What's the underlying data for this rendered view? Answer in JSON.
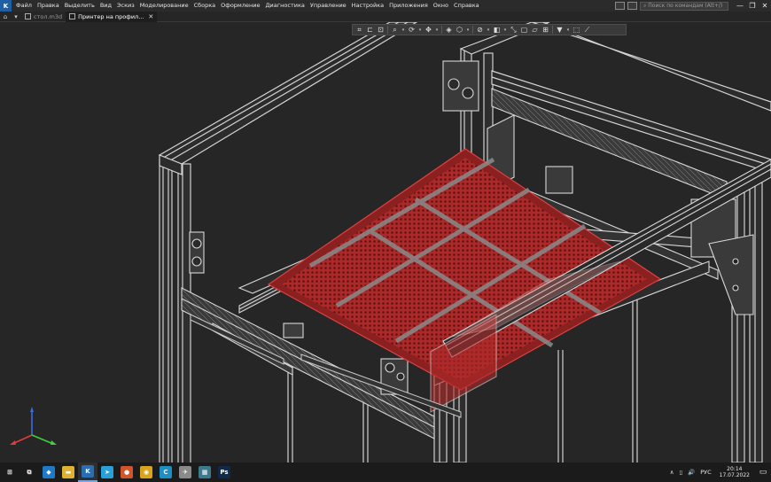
{
  "menubar": {
    "app_icon": "kompas-icon",
    "items": [
      "Файл",
      "Правка",
      "Выделить",
      "Вид",
      "Эскиз",
      "Моделирование",
      "Сборка",
      "Оформление",
      "Диагностика",
      "Управление",
      "Настройка",
      "Приложения",
      "Окно",
      "Справка"
    ],
    "search_placeholder": "Поиск по командам (Alt+/)",
    "window_controls": [
      "—",
      "❐",
      "✕"
    ]
  },
  "tabs": {
    "home_icon": "home-icon",
    "items": [
      {
        "label": "стол.m3d",
        "active": false
      },
      {
        "label": "Принтер на профил...",
        "active": true
      }
    ],
    "close_glyph": "✕"
  },
  "view_toolbar": {
    "buttons": [
      "orient-icon",
      "section-icon",
      "zoom-icon",
      "rotate-icon",
      "pan-icon",
      "view-cube-icon",
      "display-style-icon",
      "hide-icon",
      "visibility-icon",
      "filter-icon",
      "grid-icon",
      "measure-icon"
    ]
  },
  "triad": {
    "x_color": "#e23b3b",
    "y_color": "#3bd23b",
    "z_color": "#3b6be2"
  },
  "taskbar": {
    "apps": [
      {
        "name": "start-icon",
        "glyph": "⊞",
        "color": "#1b1b1b"
      },
      {
        "name": "task-view-icon",
        "glyph": "⧉",
        "color": "#1b1b1b"
      },
      {
        "name": "vscode-icon",
        "glyph": "◆",
        "color": "#1f78c8"
      },
      {
        "name": "explorer-icon",
        "glyph": "▬",
        "color": "#e0b030"
      },
      {
        "name": "kompas-icon",
        "glyph": "K",
        "color": "#2a6db3"
      },
      {
        "name": "telegram-icon",
        "glyph": "➤",
        "color": "#2aa0da"
      },
      {
        "name": "firefox-icon",
        "glyph": "●",
        "color": "#d2542a"
      },
      {
        "name": "chrome-icon",
        "glyph": "◉",
        "color": "#d8a41c"
      },
      {
        "name": "cura-icon",
        "glyph": "C",
        "color": "#1c8fc4"
      },
      {
        "name": "dragon-icon",
        "glyph": "✈",
        "color": "#8a8a8a"
      },
      {
        "name": "calculator-icon",
        "glyph": "▦",
        "color": "#3a7a8a"
      },
      {
        "name": "photoshop-icon",
        "glyph": "Ps",
        "color": "#0f2a4a"
      }
    ],
    "tray": {
      "chevron": "∧",
      "battery": "▯",
      "volume": "🔊",
      "language": "РУС",
      "time": "20:14",
      "date": "17.07.2022"
    }
  }
}
